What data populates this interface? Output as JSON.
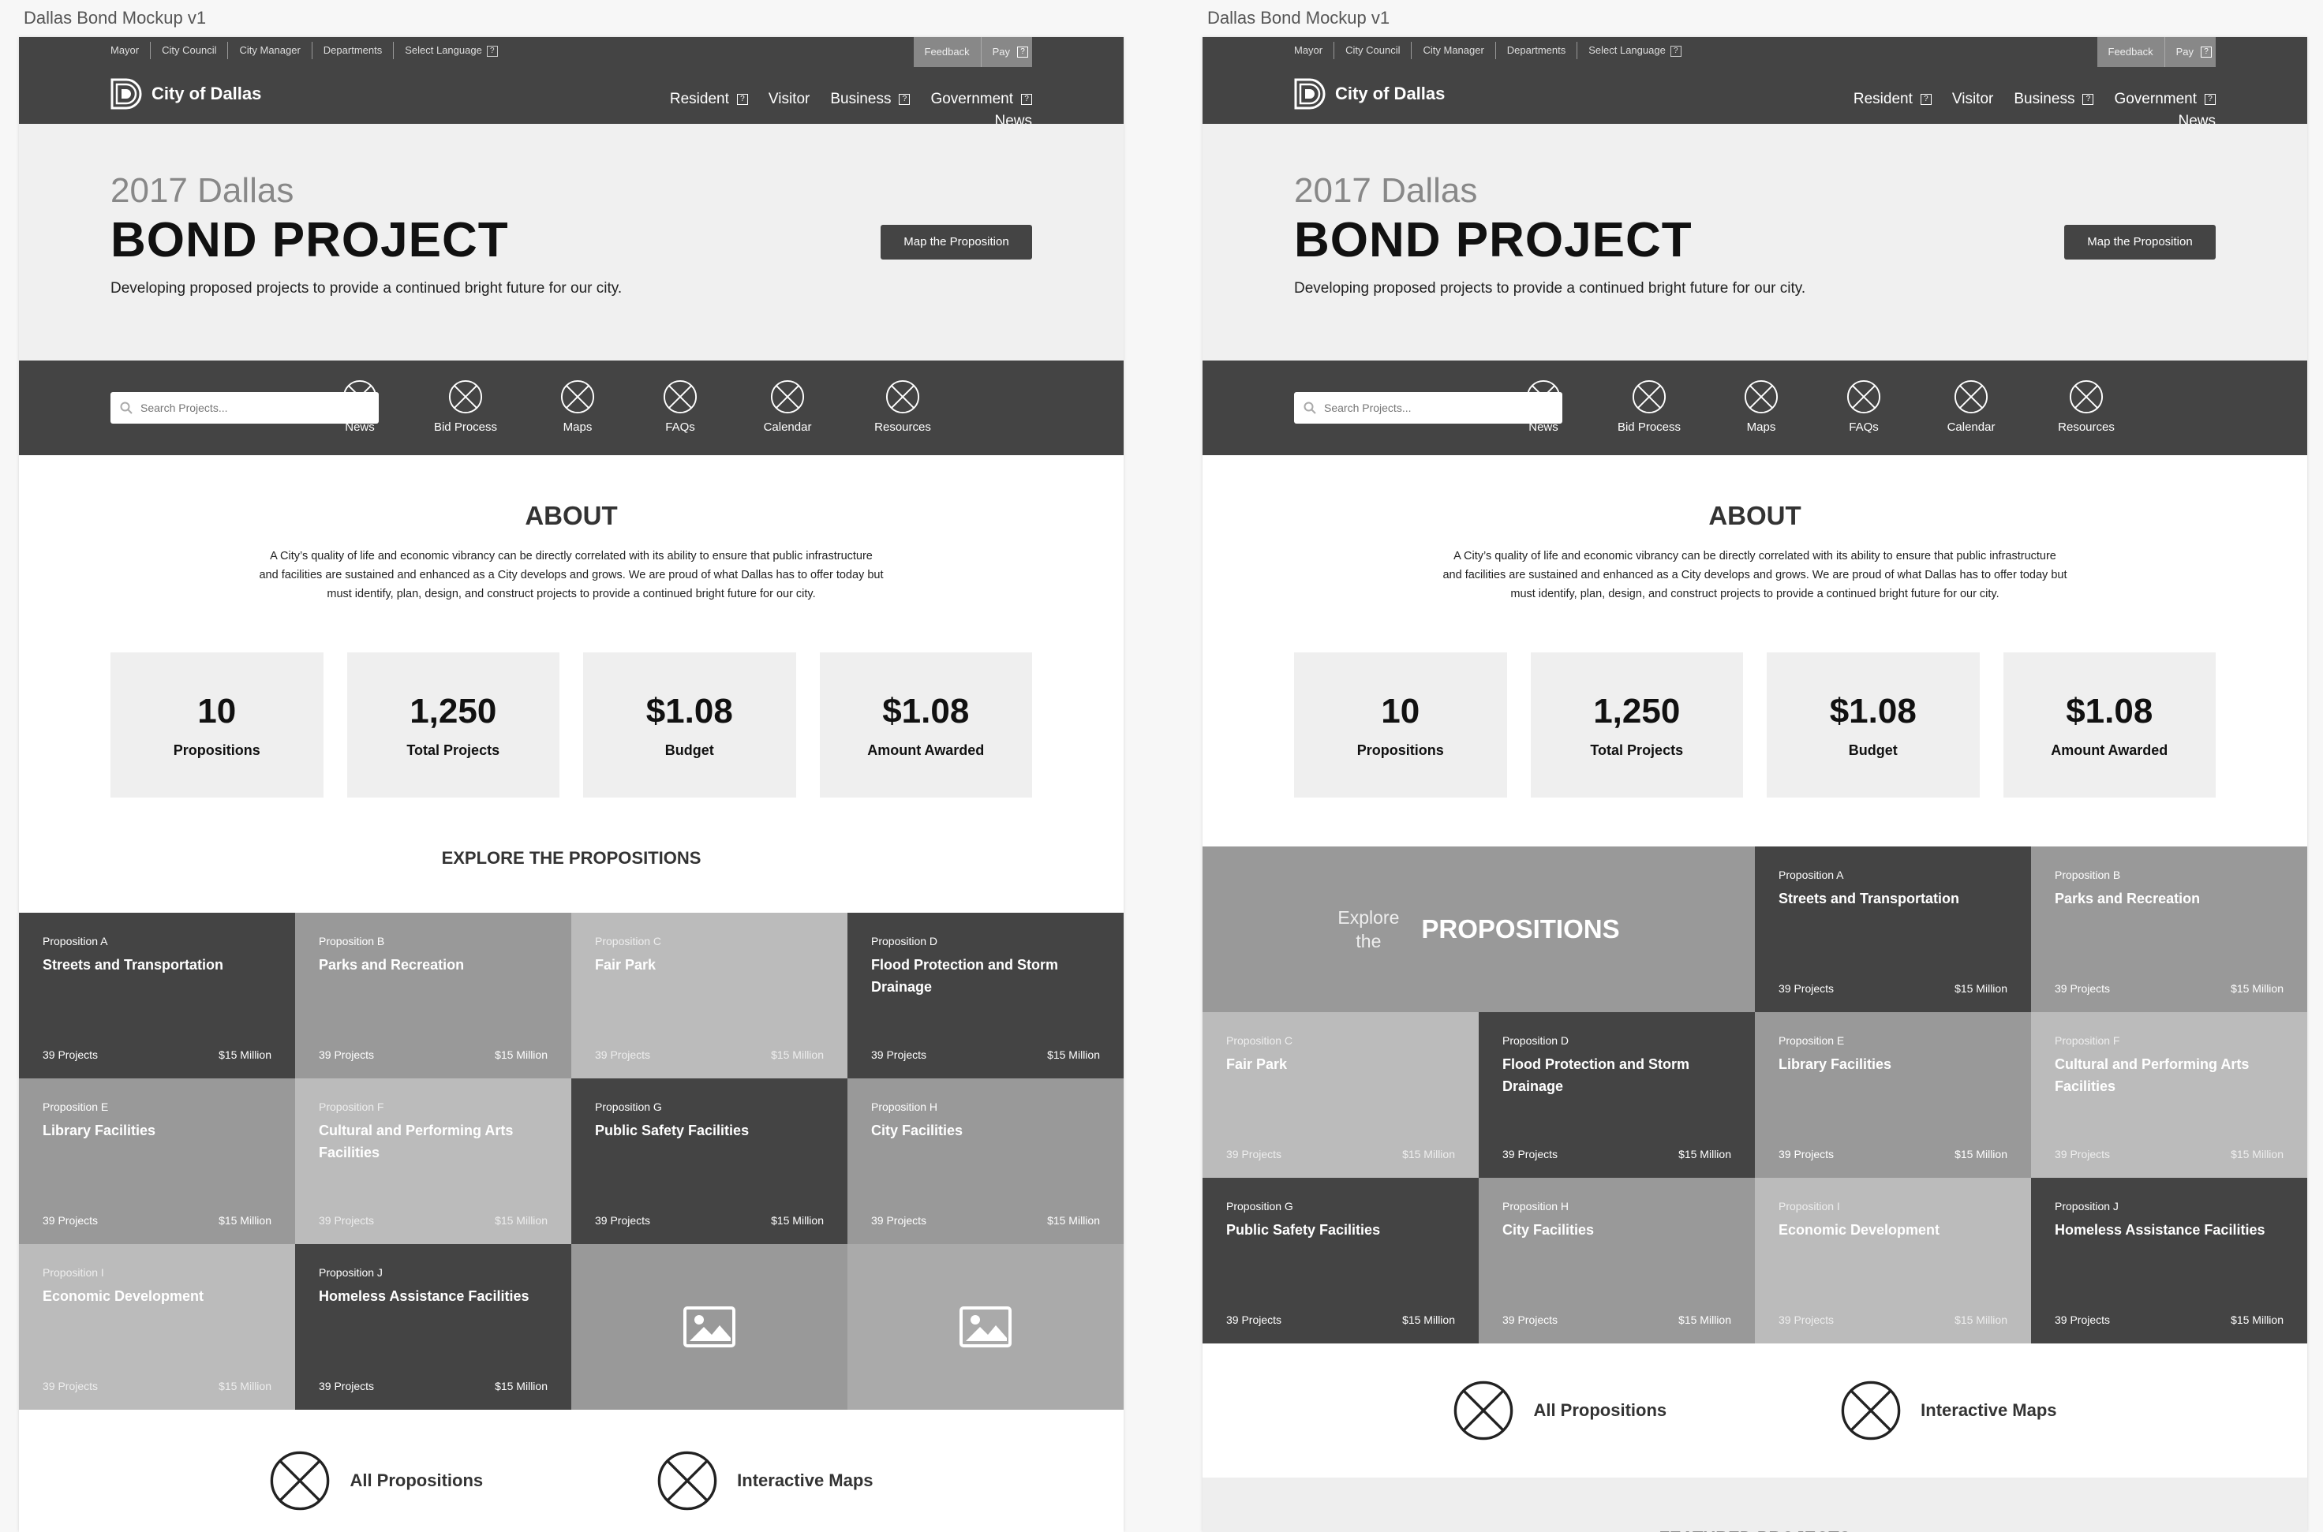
{
  "artboards": [
    "Dallas Bond Mockup v1",
    "Dallas Bond Mockup v1"
  ],
  "utility_nav": [
    "Mayor",
    "City Council",
    "City Manager",
    "Departments",
    "Select Language"
  ],
  "tools": {
    "feedback": "Feedback",
    "pay": "Pay",
    "q": "?"
  },
  "brand": "City of Dallas",
  "main_nav": {
    "resident": "Resident",
    "visitor": "Visitor",
    "business": "Business",
    "government": "Government",
    "news": "News"
  },
  "hero": {
    "year": "2017 Dallas",
    "title": "BOND PROJECT",
    "subtitle": "Developing proposed projects to provide a continued bright future for our city.",
    "button": "Map the Proposition"
  },
  "search": {
    "placeholder": "Search Projects..."
  },
  "quick_links": [
    "News",
    "Bid Process",
    "Maps",
    "FAQs",
    "Calendar",
    "Resources"
  ],
  "about": {
    "heading": "ABOUT",
    "lines": [
      "A City’s quality of life and economic vibrancy can be directly correlated with its ability to ensure that public infrastructure",
      "and facilities are sustained and enhanced as a City develops and grows. We are proud of what Dallas has to offer today but",
      "must identify, plan, design, and construct projects to provide a continued bright future for our city."
    ]
  },
  "stats": [
    {
      "value": "10",
      "label": "Propositions"
    },
    {
      "value": "1,250",
      "label": "Total Projects"
    },
    {
      "value": "$1.08",
      "label": "Budget"
    },
    {
      "value": "$1.08",
      "label": "Amount Awarded"
    }
  ],
  "explore_heading": "EXPLORE THE PROPOSITIONS",
  "explore_cell": {
    "small1": "Explore",
    "small2": "the",
    "big": "PROPOSITIONS"
  },
  "propositions": [
    {
      "label": "Proposition A",
      "name": "Streets and Transportation",
      "projects": "39 Projects",
      "amount": "$15 Million"
    },
    {
      "label": "Proposition B",
      "name": "Parks and Recreation",
      "projects": "39 Projects",
      "amount": "$15 Million"
    },
    {
      "label": "Proposition C",
      "name": "Fair Park",
      "projects": "39 Projects",
      "amount": "$15 Million"
    },
    {
      "label": "Proposition D",
      "name": "Flood Protection and Storm Drainage",
      "projects": "39 Projects",
      "amount": "$15 Million"
    },
    {
      "label": "Proposition E",
      "name": "Library Facilities",
      "projects": "39 Projects",
      "amount": "$15 Million"
    },
    {
      "label": "Proposition F",
      "name": "Cultural and Performing Arts Facilities",
      "projects": "39 Projects",
      "amount": "$15 Million"
    },
    {
      "label": "Proposition G",
      "name": "Public Safety Facilities",
      "projects": "39 Projects",
      "amount": "$15 Million"
    },
    {
      "label": "Proposition H",
      "name": "City Facilities",
      "projects": "39 Projects",
      "amount": "$15 Million"
    },
    {
      "label": "Proposition I",
      "name": "Economic Development",
      "projects": "39 Projects",
      "amount": "$15 Million"
    },
    {
      "label": "Proposition J",
      "name": "Homeless Assistance Facilities",
      "projects": "39 Projects",
      "amount": "$15 Million"
    }
  ],
  "bottom_links": [
    "All Propositions",
    "Interactive Maps"
  ],
  "featured_heading": "FEATURED PROJECTS"
}
